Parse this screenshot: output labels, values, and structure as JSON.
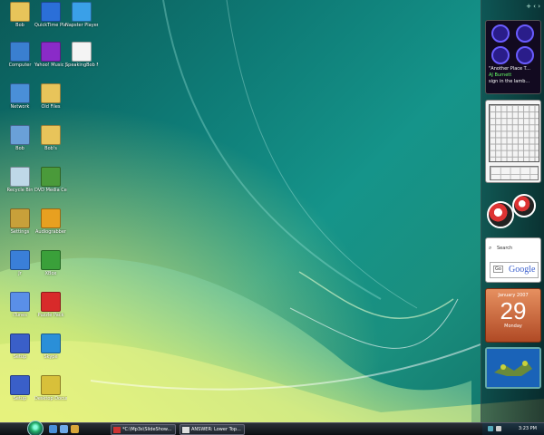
{
  "desktop_icons": [
    {
      "id": "bob",
      "label": "Bob",
      "icon": "folder-icon"
    },
    {
      "id": "quicktime",
      "label": "QuickTime Player",
      "icon": "quicktime-icon"
    },
    {
      "id": "napster",
      "label": "Napster Player",
      "icon": "napster-icon"
    },
    {
      "id": "computer",
      "label": "Computer",
      "icon": "computer-icon"
    },
    {
      "id": "yahoo-music",
      "label": "Yahoo! Music Jukebox",
      "icon": "yahoo-music-icon"
    },
    {
      "id": "speakingbob",
      "label": "SpeakingBob Media Player",
      "icon": "media-file-icon"
    },
    {
      "id": "network",
      "label": "Network",
      "icon": "network-icon"
    },
    {
      "id": "old-files",
      "label": "Old Files",
      "icon": "folder-icon"
    },
    {
      "id": "bob2",
      "label": "Bob",
      "icon": "user-icon"
    },
    {
      "id": "bob-doc",
      "label": "Bob's",
      "icon": "folder-icon"
    },
    {
      "id": "recycle-bin",
      "label": "Recycle Bin",
      "icon": "recycle-bin-icon"
    },
    {
      "id": "dvd-media",
      "label": "DVD Media Center",
      "icon": "dvd-icon"
    },
    {
      "id": "settings",
      "label": "Settings",
      "icon": "settings-icon"
    },
    {
      "id": "audiograbber",
      "label": "Audiograbber",
      "icon": "audio-icon"
    },
    {
      "id": "jr-app",
      "label": "Jr",
      "icon": "app-j-icon"
    },
    {
      "id": "xbox",
      "label": "XBox",
      "icon": "xbox-icon"
    },
    {
      "id": "itunes",
      "label": "iTunes",
      "icon": "itunes-icon"
    },
    {
      "id": "puzzle",
      "label": "Puzzle Pack",
      "icon": "puzzle-icon"
    },
    {
      "id": "setup-a",
      "label": "Setup",
      "icon": "setup-icon"
    },
    {
      "id": "skype",
      "label": "Skype",
      "icon": "skype-icon"
    },
    {
      "id": "setup-b",
      "label": "Setup",
      "icon": "setup-icon"
    },
    {
      "id": "desktop-docs",
      "label": "Desktop Documents",
      "icon": "docs-icon"
    }
  ],
  "gadgets": {
    "media": {
      "line1": "\"Another Place T...",
      "line2": "AJ Burnett",
      "line3": "sign in the lamb..."
    },
    "search": {
      "label": "Search",
      "go": "Go",
      "brand": "Google"
    },
    "calendar": {
      "month": "January 2007",
      "day": "29",
      "weekday": "Monday"
    }
  },
  "taskbar": {
    "buttons": [
      {
        "label": "*C:\\Mp3s\\SlideShow...",
        "icon": "window-icon"
      },
      {
        "label": "ANSWER: Lower Top...",
        "icon": "document-icon"
      }
    ],
    "clock": "3:23 PM"
  },
  "colors": {
    "wallpaper": "#0e7a75",
    "taskbar": "#1a1f26",
    "calendar": "#c85a30"
  }
}
